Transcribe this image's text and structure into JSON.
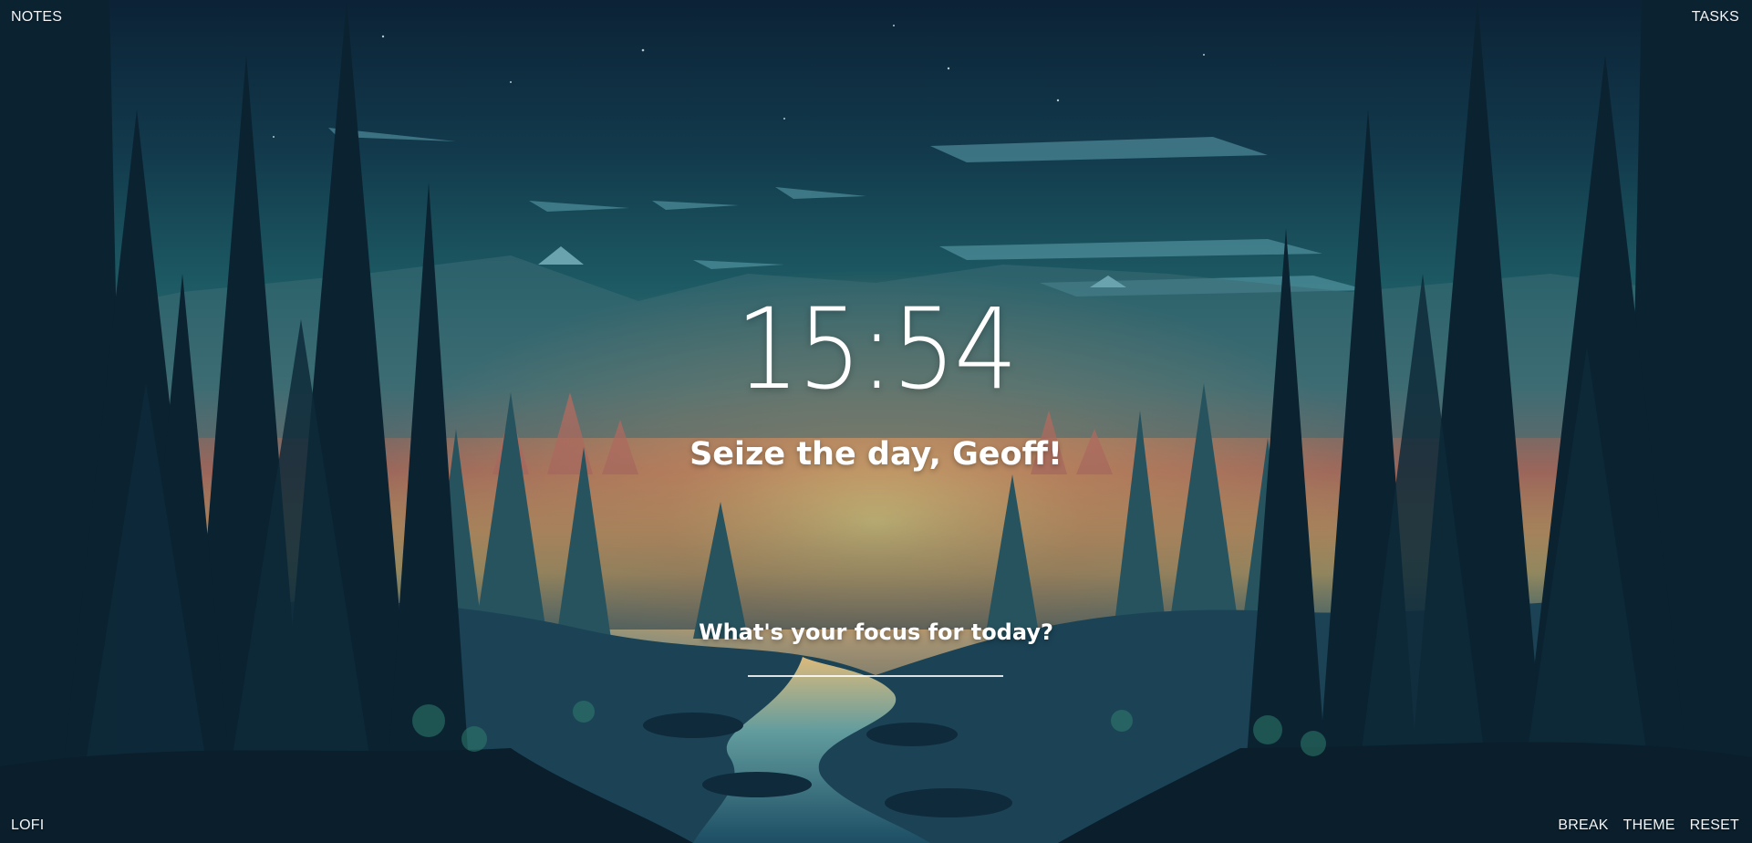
{
  "nav": {
    "notes_label": "NOTES",
    "tasks_label": "TASKS",
    "lofi_label": "LOFI",
    "break_label": "BREAK",
    "theme_label": "THEME",
    "reset_label": "RESET"
  },
  "clock": {
    "time": "15:54"
  },
  "greeting": {
    "text": "Seize the day, Geoff!"
  },
  "focus": {
    "question": "What's your focus for today?",
    "value": "",
    "placeholder": ""
  },
  "background": {
    "description_icon": "forest-sunset-wallpaper",
    "colors": {
      "sky_top": "#0c2236",
      "sky_mid": "#1d5a63",
      "horizon_glow": "#e3b766",
      "sunset_red": "#b56858",
      "foreground_dark": "#0a1a28"
    }
  }
}
